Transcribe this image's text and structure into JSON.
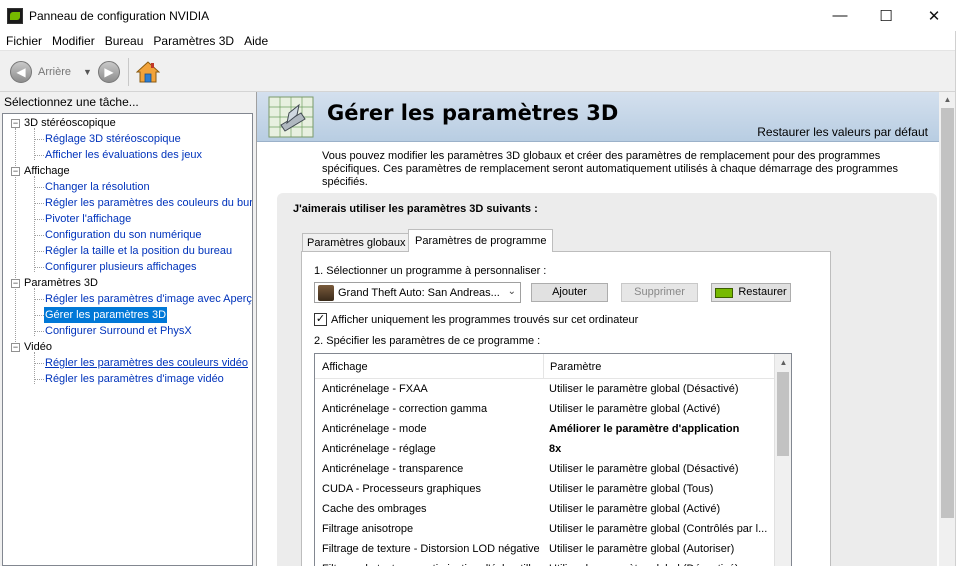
{
  "window": {
    "title": "Panneau de configuration NVIDIA",
    "minimize": "—",
    "maximize": "☐",
    "close": "✕"
  },
  "menu": [
    "Fichier",
    "Modifier",
    "Bureau",
    "Paramètres 3D",
    "Aide"
  ],
  "toolbar": {
    "back_label": "Arrière",
    "back_glyph": "◀",
    "forward_glyph": "▶",
    "dropdown_glyph": "▼"
  },
  "sidebar": {
    "task_label": "Sélectionnez une tâche...",
    "categories": [
      {
        "label": "3D stéréoscopique",
        "items": [
          "Réglage 3D stéréoscopique",
          "Afficher les évaluations des jeux"
        ]
      },
      {
        "label": "Affichage",
        "items": [
          "Changer la résolution",
          "Régler les paramètres des couleurs du bureau",
          "Pivoter l'affichage",
          "Configuration du son numérique",
          "Régler la taille et la position du bureau",
          "Configurer plusieurs affichages"
        ]
      },
      {
        "label": "Paramètres 3D",
        "items": [
          "Régler les paramètres d'image avec Aperçu",
          "Gérer les paramètres 3D",
          "Configurer Surround et PhysX"
        ]
      },
      {
        "label": "Vidéo",
        "items": [
          "Régler les paramètres des couleurs vidéo",
          "Régler les paramètres d'image vidéo"
        ]
      }
    ],
    "expander": "−",
    "selected": "Gérer les paramètres 3D"
  },
  "main": {
    "title": "Gérer les paramètres 3D",
    "restore_defaults": "Restaurer les valeurs par défaut",
    "description": "Vous pouvez modifier les paramètres 3D globaux et créer des paramètres de remplacement pour des programmes spécifiques. Ces paramètres de remplacement seront automatiquement utilisés à chaque démarrage des programmes spécifiés.",
    "panel_heading": "J'aimerais utiliser les paramètres 3D suivants :",
    "tabs": [
      "Paramètres globaux",
      "Paramètres de programme"
    ],
    "active_tab": "Paramètres de programme",
    "step1": "1. Sélectionner un programme à personnaliser :",
    "program_selected": "Grand Theft Auto: San Andreas...",
    "select_arrow": "⌄",
    "add_button": "Ajouter",
    "remove_button": "Supprimer",
    "restore_button": "Restaurer",
    "only_found_label": "Afficher uniquement les programmes trouvés sur cet ordinateur",
    "only_found_checked": true,
    "check_glyph": "✓",
    "step2": "2. Spécifier les paramètres de ce programme :",
    "table": {
      "headers": [
        "Affichage",
        "Paramètre"
      ],
      "rows": [
        {
          "feature": "Anticrénelage - FXAA",
          "setting": "Utiliser le paramètre global (Désactivé)"
        },
        {
          "feature": "Anticrénelage - correction gamma",
          "setting": "Utiliser le paramètre global (Activé)"
        },
        {
          "feature": "Anticrénelage - mode",
          "setting": "Améliorer le paramètre d'application"
        },
        {
          "feature": "Anticrénelage - réglage",
          "setting": "8x"
        },
        {
          "feature": "Anticrénelage - transparence",
          "setting": "Utiliser le paramètre global (Désactivé)"
        },
        {
          "feature": "CUDA - Processeurs graphiques",
          "setting": "Utiliser le paramètre global (Tous)"
        },
        {
          "feature": "Cache des ombrages",
          "setting": "Utiliser le paramètre global (Activé)"
        },
        {
          "feature": "Filtrage anisotrope",
          "setting": "Utiliser le paramètre global (Contrôlés par l..."
        },
        {
          "feature": "Filtrage de texture - Distorsion LOD négative",
          "setting": "Utiliser le paramètre global (Autoriser)"
        },
        {
          "feature": "Filtrage de texture - optimisation d'échantillon...",
          "setting": "Utiliser le paramètre global (Désactivé)"
        }
      ],
      "bold_rows": [
        2,
        3
      ],
      "scroll_up": "▲"
    }
  },
  "colors": {
    "nvidia_green": "#76b900",
    "link_blue": "#0033bb",
    "selection_blue": "#0078d7",
    "banner_top": "#d4e0ee"
  }
}
